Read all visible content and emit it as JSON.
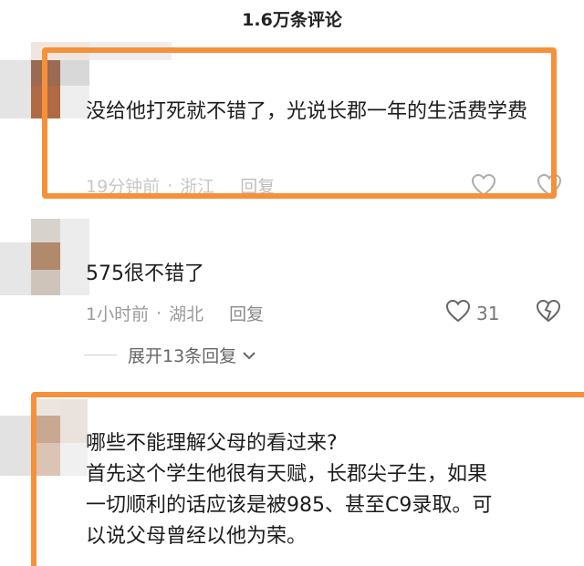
{
  "header": {
    "title": "1.6万条评论"
  },
  "comments": [
    {
      "text": "没给他打死就不错了，光说长郡一年的生活费学费",
      "time": "19分钟前",
      "location": "浙江",
      "reply_label": "回复"
    },
    {
      "text": "575很不错了",
      "time": "1小时前",
      "location": "湖北",
      "reply_label": "回复",
      "likes": "31",
      "expand_label": "展开13条回复"
    },
    {
      "lines": [
        "哪些不能理解父母的看过来?",
        "首先这个学生他很有天赋，长郡尖子生，如果",
        "一切顺利的话应该是被985、甚至C9录取。可",
        "以说父母曾经以他为荣。"
      ]
    }
  ],
  "colors": {
    "highlight": "#f5913a",
    "meta": "#9a9a9a"
  },
  "icons": [
    "heart-icon",
    "dislike-icon",
    "chevron-down-icon"
  ]
}
